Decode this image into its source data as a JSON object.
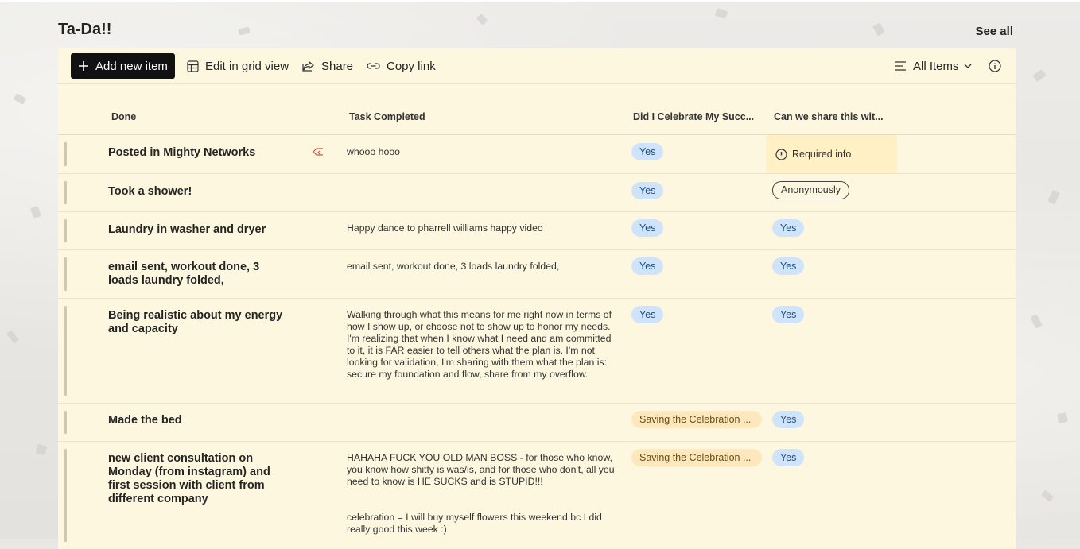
{
  "page": {
    "title": "Ta-Da!!",
    "see_all": "See all"
  },
  "toolbar": {
    "add": "Add new item",
    "edit_grid": "Edit in grid view",
    "share": "Share",
    "copy_link": "Copy link",
    "view": "All Items"
  },
  "columns": {
    "done": "Done",
    "task": "Task Completed",
    "celebrate": "Did I Celebrate My Succ...",
    "share": "Can we share this wit..."
  },
  "rows": [
    {
      "done": "Posted in Mighty Networks",
      "task": "whooo hooo",
      "celebrate": "Yes",
      "share": "Required info"
    },
    {
      "done": "Took a shower!",
      "task": "",
      "celebrate": "Yes",
      "share": "Anonymously"
    },
    {
      "done": "Laundry in washer and dryer",
      "task": "Happy dance to pharrell williams happy video",
      "celebrate": "Yes",
      "share": "Yes"
    },
    {
      "done": "email sent, workout done, 3 loads laundry folded,",
      "task": "email sent, workout done, 3 loads laundry folded,",
      "celebrate": "Yes",
      "share": "Yes"
    },
    {
      "done": "Being realistic about my energy and capacity",
      "task": "Walking through what this means for me right now in terms of how I show up, or choose not to show up to honor my needs. I'm realizing that when I know what I need and am committed to it, it is FAR easier to tell others what the plan is. I'm not looking for validation, I'm sharing with them what the plan is: secure my foundation and flow, share from my overflow.",
      "celebrate": "Yes",
      "share": "Yes"
    },
    {
      "done": "Made the bed",
      "task": "",
      "celebrate": "Saving the Celebration ...",
      "share": "Yes"
    },
    {
      "done": "new client consultation on Monday (from instagram) and first session with client from different company",
      "task": "HAHAHA FUCK YOU OLD MAN BOSS - for those who know, you know how shitty is was/is, and for those who don't, all you need to know is HE SUCKS and is STUPID!!!",
      "task2": "celebration = I will buy myself flowers this weekend bc I did really good this week :)",
      "celebrate": "Saving the Celebration ...",
      "share": "Yes"
    }
  ]
}
